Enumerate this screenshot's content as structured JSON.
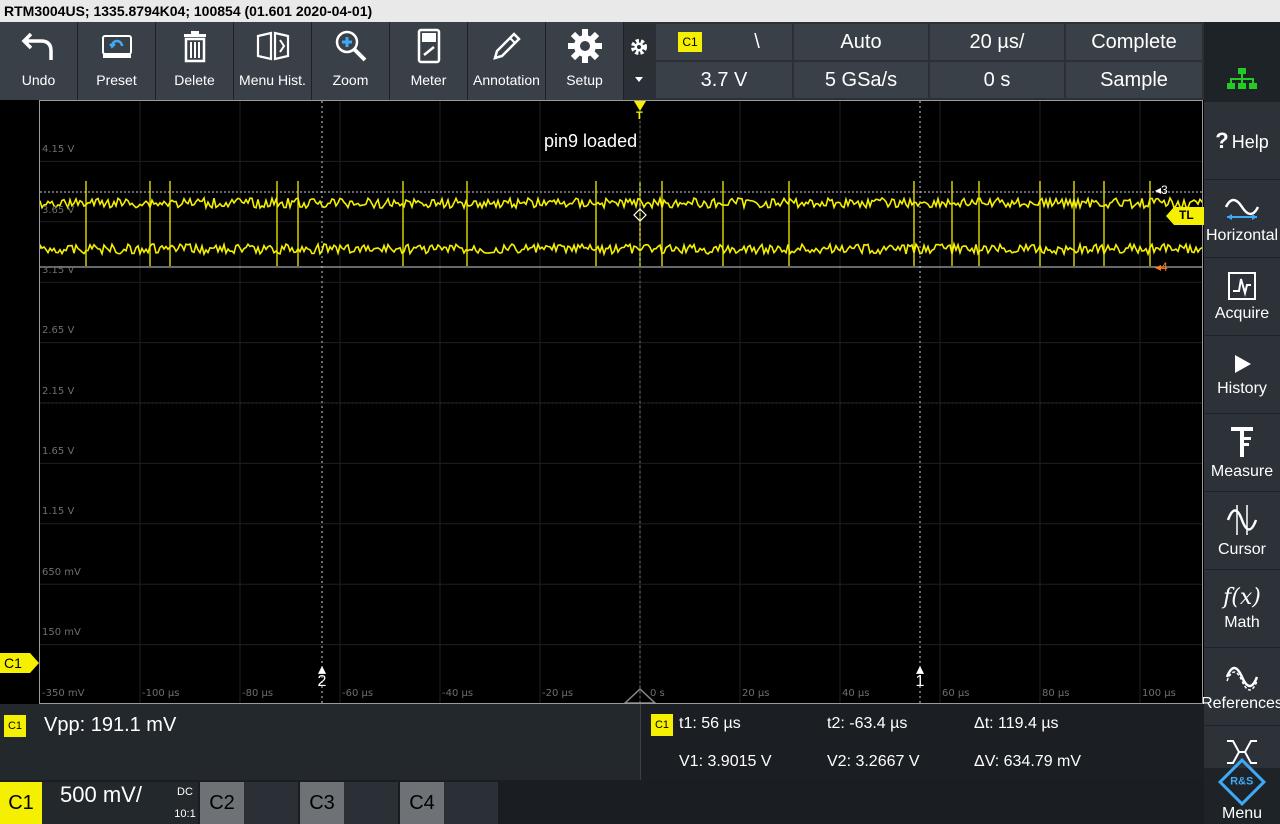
{
  "title_bar": "RTM3004US; 1335.8794K04; 100854 (01.601 2020-04-01)",
  "toolbar": [
    {
      "label": "Undo",
      "icon": "undo-icon"
    },
    {
      "label": "Preset",
      "icon": "preset-icon"
    },
    {
      "label": "Delete",
      "icon": "trash-icon"
    },
    {
      "label": "Menu Hist.",
      "icon": "book-icon"
    },
    {
      "label": "Zoom",
      "icon": "zoom-icon"
    },
    {
      "label": "Meter",
      "icon": "meter-icon"
    },
    {
      "label": "Annotation",
      "icon": "pencil-icon"
    },
    {
      "label": "Setup",
      "icon": "gear-icon"
    }
  ],
  "trigger": {
    "source": "C1",
    "slope": "\\",
    "level": "3.7 V",
    "mode": "Auto",
    "sample_rate": "5 GSa/s",
    "timebase": "20 µs/",
    "delay": "0 s",
    "acq_state": "Complete",
    "acq_mode": "Sample"
  },
  "right_menu": [
    {
      "label": "Help",
      "icon": "help-icon"
    },
    {
      "label": "Horizontal",
      "icon": "horizontal-icon"
    },
    {
      "label": "Acquire",
      "icon": "acquire-icon"
    },
    {
      "label": "History",
      "icon": "play-icon"
    },
    {
      "label": "Measure",
      "icon": "caliper-icon"
    },
    {
      "label": "Cursor",
      "icon": "cursor-icon"
    },
    {
      "label": "Math",
      "icon": "math-icon",
      "glyph": "f(x)"
    },
    {
      "label": "References",
      "icon": "reference-icon"
    },
    {
      "label": "",
      "icon": "protocol-icon"
    },
    {
      "label": "Menu",
      "icon": "rs-logo-icon",
      "logo_text": "R&S"
    }
  ],
  "help_mark": "?",
  "screen": {
    "annotation": "pin9 loaded",
    "y_labels": [
      "4.15 V",
      "3.65 V",
      "3.15 V",
      "2.65 V",
      "2.15 V",
      "1.65 V",
      "1.15 V",
      "650 mV",
      "150 mV",
      "-350 mV"
    ],
    "x_labels": [
      "-100 µs",
      "-80 µs",
      "-60 µs",
      "-40 µs",
      "-20 µs",
      "0 s",
      "20 µs",
      "40 µs",
      "60 µs",
      "80 µs",
      "100 µs"
    ],
    "cursor_v3_label": "3",
    "cursor_v4_label": "4",
    "cursor_t1_label": "1",
    "cursor_t2_label": "2",
    "trigger_level_tag": "TL",
    "channel_marker": "C1",
    "trigger_marker": "T"
  },
  "colors": {
    "trace": "#f5f000",
    "cursor_marker": "#ff7a1a",
    "panel": "#3a4048",
    "network_icon": "#22cc22"
  },
  "measurement": {
    "channel": "C1",
    "text": "Vpp: 191.1 mV"
  },
  "cursor_results": {
    "channel": "C1",
    "t1": "t1: 56 µs",
    "t2": "t2: -63.4 µs",
    "dt": "Δt: 119.4 µs",
    "v1": "V1: 3.9015 V",
    "v2": "V2: 3.2667 V",
    "dv": "ΔV: 634.79 mV"
  },
  "channels": [
    {
      "name": "C1",
      "scale": "500 mV/",
      "coupling": "DC",
      "probe": "10:1",
      "active": true
    },
    {
      "name": "C2",
      "active": false
    },
    {
      "name": "C3",
      "active": false
    },
    {
      "name": "C4",
      "active": false
    }
  ]
}
